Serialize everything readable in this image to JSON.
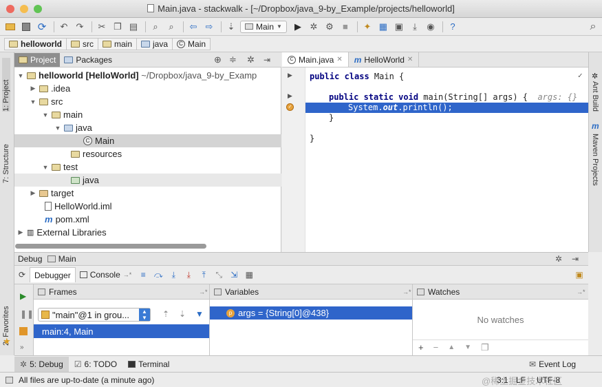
{
  "window": {
    "title": "Main.java - stackwalk - [~/Dropbox/java_9-by_Example/projects/helloworld]"
  },
  "toolbar": {
    "run_config": "Main"
  },
  "breadcrumbs": [
    "helloworld",
    "src",
    "main",
    "java",
    "Main"
  ],
  "project_panel": {
    "tabs": [
      "Project",
      "Packages"
    ],
    "tree": [
      {
        "label": "helloworld [HelloWorld]",
        "suffix": "~/Dropbox/java_9-by_Examp"
      },
      {
        "label": ".idea"
      },
      {
        "label": "src"
      },
      {
        "label": "main"
      },
      {
        "label": "java"
      },
      {
        "label": "Main"
      },
      {
        "label": "resources"
      },
      {
        "label": "test"
      },
      {
        "label": "java"
      },
      {
        "label": "target"
      },
      {
        "label": "HelloWorld.iml"
      },
      {
        "label": "pom.xml"
      },
      {
        "label": "External Libraries"
      }
    ]
  },
  "left_tool_tabs": [
    "1: Project",
    "7: Structure",
    "2: Favorites"
  ],
  "right_tool_tabs": [
    "Ant Build",
    "Maven Projects"
  ],
  "editor": {
    "tabs": [
      "Main.java",
      "HelloWorld"
    ],
    "lines": {
      "l1_kw": "public class",
      "l1_rest": " Main {",
      "l2_kw": "public static void",
      "l2_rest": " main(String[] args) {",
      "l2_hint": "args: {}",
      "l3_prefix": "System.",
      "l3_italic": "out",
      "l3_rest": ".println();",
      "l4": "}",
      "l5": "}"
    }
  },
  "debug": {
    "header_label": "Debug",
    "config": "Main",
    "tabs": [
      "Debugger",
      "Console"
    ],
    "frames_title": "Frames",
    "thread": "\"main\"@1 in grou...",
    "frame": "main:4, Main",
    "variables_title": "Variables",
    "variable": "args = {String[0]@438}",
    "watches_title": "Watches",
    "watches_empty": "No watches"
  },
  "bottom_tabs": [
    "5: Debug",
    "6: TODO",
    "Terminal",
    "Event Log"
  ],
  "status": {
    "message": "All files are up-to-date (a minute ago)",
    "position": "3:1",
    "line_sep": "LF",
    "encoding": "UTF-8"
  },
  "watermark": "@稀土掘金技术社区",
  "colors": {
    "selection": "#2f65ca",
    "keyword": "#000080",
    "frame_selection": "#2f65ca"
  }
}
